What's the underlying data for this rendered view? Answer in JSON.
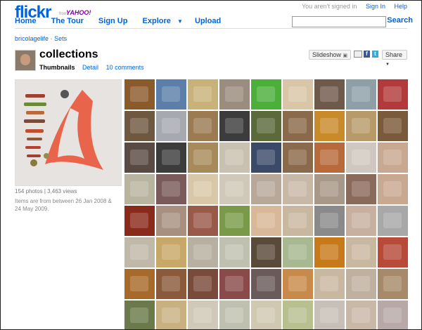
{
  "header": {
    "logo_main": "flickr",
    "logo_from": "from",
    "logo_yahoo": "YAHOO!",
    "status": "You aren't signed in",
    "sign_in": "Sign In",
    "help": "Help",
    "nav": [
      "Home",
      "The Tour",
      "Sign Up",
      "Explore",
      "Upload"
    ],
    "search_button": "Search",
    "search_value": ""
  },
  "breadcrumb": {
    "user": "bricolagelife",
    "separator": "·",
    "section": "Sets"
  },
  "page": {
    "title": "collections",
    "tabs": {
      "current": "Thumbnails",
      "detail": "Detail",
      "comments": "10 comments"
    }
  },
  "actions": {
    "slideshow": "Slideshow",
    "share": "Share"
  },
  "set_info": {
    "stats": "154 photos | 3,463 views",
    "date_range": "Items are from between 26 Jan 2008 & 24 May 2009."
  },
  "colors": {
    "link": "#0063dc",
    "flickr_pink": "#ff0084",
    "yahoo_purple": "#7b0099"
  },
  "thumbnails": [
    [
      "#8b5a2b",
      "#5b7fa8",
      "#c9b27a",
      "#9a8c7e",
      "#4caf3a",
      "#d8c6a6",
      "#6e5a4a",
      "#8e9fa8",
      "#b23a3a"
    ],
    [
      "#6f5840",
      "#a7a9b0",
      "#9c7a52",
      "#3c3c3c",
      "#5a6a3a",
      "#8a6a4a",
      "#c98a2a",
      "#b89a6a",
      "#7a5a3a"
    ],
    [
      "#5a4a44",
      "#3c3c3c",
      "#a88a5a",
      "#c8c0b0",
      "#3c4a6a",
      "#8a6a4a",
      "#b86a3a",
      "#d0c8c0",
      "#c8a890"
    ],
    [
      "#b8b4a0",
      "#7a5a5a",
      "#d8c8a8",
      "#d0c8b8",
      "#b8a89a",
      "#c8b8a8",
      "#a89888",
      "#8a6a5a",
      "#c8a890"
    ],
    [
      "#8a2a1a",
      "#a89080",
      "#9a5a4a",
      "#7a9a4a",
      "#d8b898",
      "#c8b8a0",
      "#8a8a8a",
      "#c8b0a0",
      "#a8a8a8"
    ],
    [
      "#c0b8a8",
      "#c8a868",
      "#b8b0a0",
      "#c0c0b0",
      "#5a4a3a",
      "#a8b890",
      "#c87a1a",
      "#c8b8a0",
      "#b84a3a"
    ],
    [
      "#a86a2a",
      "#8a5a3a",
      "#7a4a3a",
      "#8a4a4a",
      "#6a5a5a",
      "#c88a4a",
      "#c8b8a0",
      "#c0b0a0",
      "#a88a6a"
    ],
    [
      "#6a7a4a",
      "#c8b080",
      "#d0c8b8",
      "#c0c0b0",
      "#d0c8b0",
      "#b8c090",
      "#c8c0b8",
      "#c8b8a8",
      "#b8a8a8"
    ]
  ]
}
